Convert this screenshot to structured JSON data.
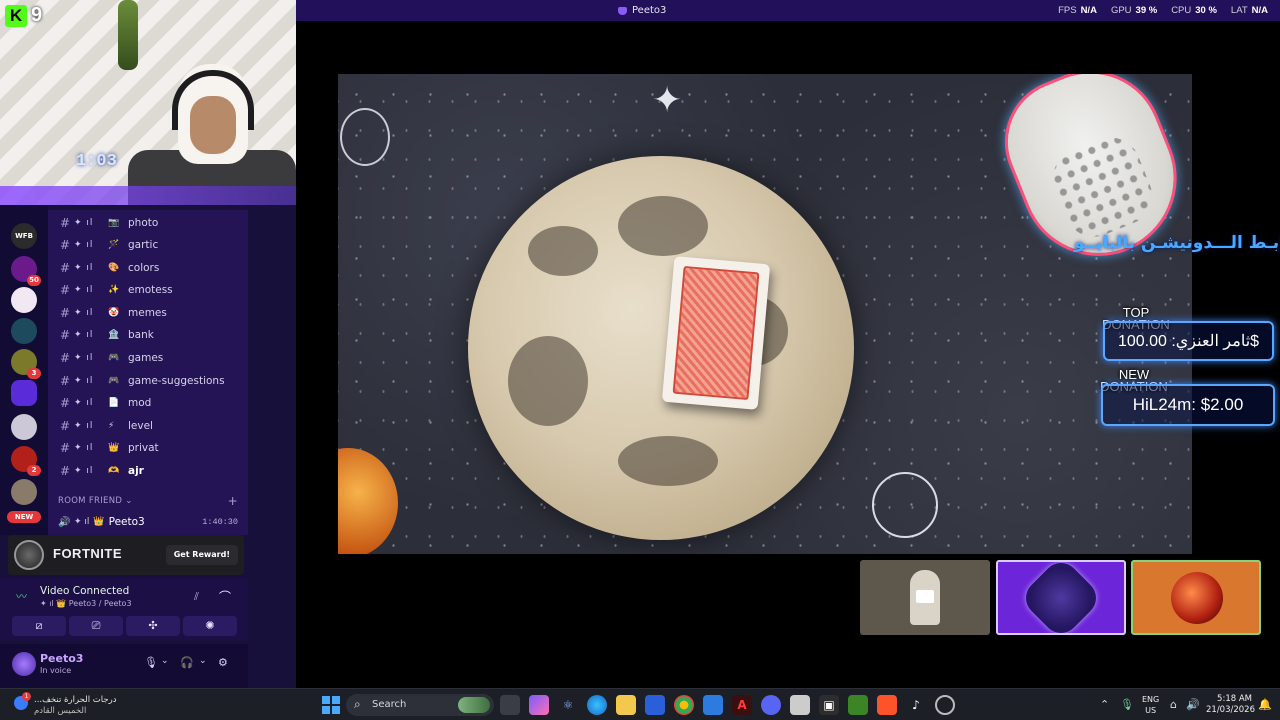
{
  "window": {
    "title": "Peeto3"
  },
  "perf": [
    {
      "label": "FPS",
      "value": "N/A"
    },
    {
      "label": "GPU",
      "value": "39 %"
    },
    {
      "label": "CPU",
      "value": "30 %"
    },
    {
      "label": "LAT",
      "value": "N/A"
    }
  ],
  "webcam": {
    "kick_count": "9",
    "timer": "1:03",
    "kick_logo": "K"
  },
  "overlay": {
    "donation_link": "رابـط الـــدونيشـن بالبايــو",
    "top_donation_label": "TOP\nDONATION",
    "top_donation_value": "ثامر العنزي: 100.00$",
    "new_donation_label": "NEW\nDONATION",
    "new_donation_value": "HiL24m: $2.00"
  },
  "channels": [
    {
      "sym": "✦ ıl",
      "emoji": "📷",
      "name": "photo"
    },
    {
      "sym": "✦ ıl",
      "emoji": "🪄",
      "name": "gartic"
    },
    {
      "sym": "✦ ıl",
      "emoji": "🎨",
      "name": "colors"
    },
    {
      "sym": "✦ ıl",
      "emoji": "✨",
      "name": "emotess"
    },
    {
      "sym": "✦ ıl",
      "emoji": "🤡",
      "name": "memes"
    },
    {
      "sym": "✦ ıl",
      "emoji": "🏦",
      "name": "bank"
    },
    {
      "sym": "✦ ıl",
      "emoji": "🎮",
      "name": "games"
    },
    {
      "sym": "✦ ıl",
      "emoji": "🎮",
      "name": "game-suggestions"
    },
    {
      "sym": "✦ ıl",
      "emoji": "📄",
      "name": "mod"
    },
    {
      "sym": "✦ ıl",
      "emoji": "⚡",
      "name": "level"
    },
    {
      "sym": "✦ ıl",
      "emoji": "👑",
      "name": "privat"
    },
    {
      "sym": "✦ ıl",
      "emoji": "🫶",
      "name": "ajr"
    }
  ],
  "category": {
    "label": "ROOM FRIEND",
    "plus": "+"
  },
  "voice_user": {
    "sym": "✦ ıl",
    "emoji": "👑",
    "name": "Peeto3",
    "time": "1:40:30"
  },
  "servers": {
    "badges": [
      "50",
      "3",
      "2"
    ],
    "new_label": "NEW",
    "wfb": "WFB"
  },
  "fortnite": {
    "title": "FORTNITE",
    "button": "Get Reward!"
  },
  "voice_panel": {
    "status": "Video Connected",
    "sub": "✦ ıl 👑 Peeto3 / Peeto3"
  },
  "user_panel": {
    "name": "Peeto3",
    "status": "In voice"
  },
  "taskbar": {
    "weather_line1": "درجات الحرارة تنخف...",
    "weather_line2": "الخميس القادم",
    "weather_badge": "1",
    "search_label": "Search",
    "lang_top": "ENG",
    "lang_bottom": "US",
    "time": "5:18 AM",
    "date": "21/03/2026"
  },
  "icons": {
    "search": "⌕",
    "video": "📹",
    "mic": "🎤",
    "headphones": "🎧",
    "gear": "⚙",
    "hangup": "☎",
    "signal": "📶",
    "cam_off": "⦸",
    "screen": "🖥",
    "activity": "✤",
    "soundboard": "✺"
  }
}
